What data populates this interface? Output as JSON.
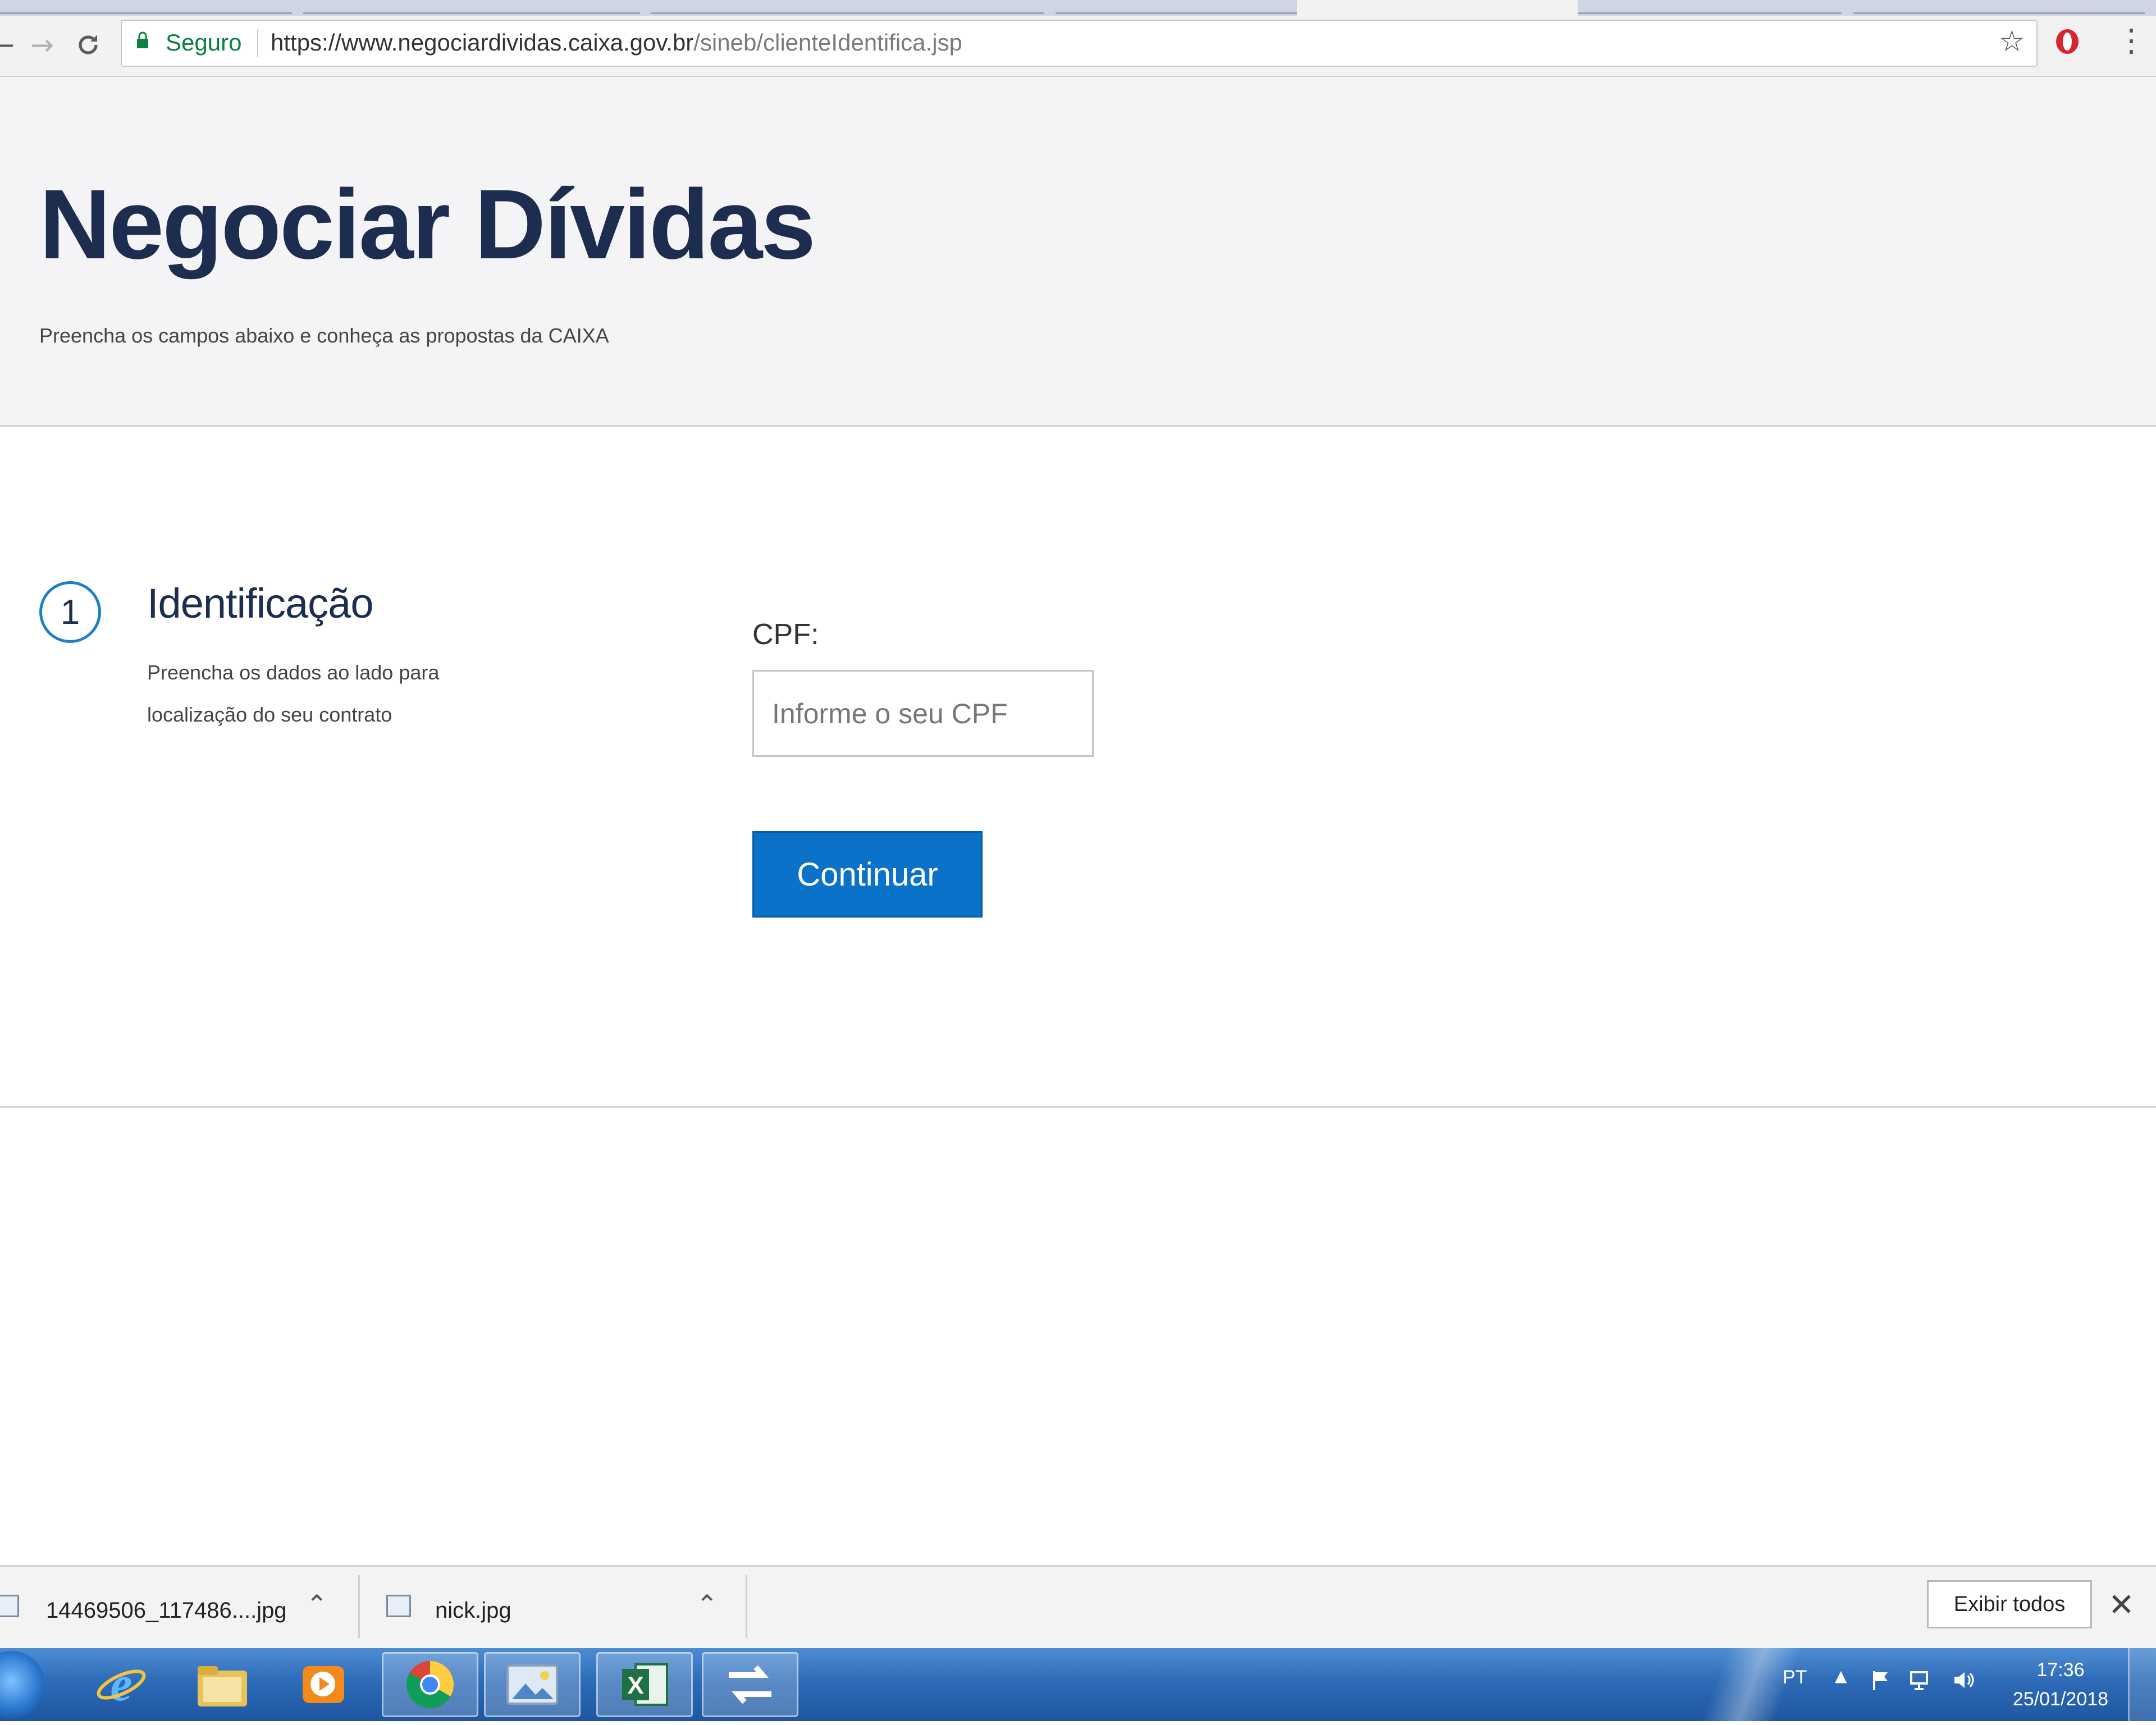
{
  "browser": {
    "security_label": "Seguro",
    "url_host": "https://www.negociardividas.caixa.gov.br",
    "url_path": "/sineb/clienteIdentifica.jsp",
    "back_icon": "back-arrow-icon",
    "forward_icon": "forward-arrow-icon",
    "reload_icon": "reload-icon"
  },
  "header": {
    "title": "Negociar Dívidas",
    "subtitle": "Preencha os campos abaixo e conheça as propostas da CAIXA"
  },
  "step": {
    "number": "1",
    "title": "Identificação",
    "description": "Preencha os dados ao lado para localização do seu contrato"
  },
  "form": {
    "cpf_label": "CPF:",
    "cpf_placeholder": "Informe o seu CPF",
    "cpf_value": "",
    "continue_label": "Continuar"
  },
  "downloads": {
    "items": [
      {
        "name": "14469506_117486....jpg"
      },
      {
        "name": "nick.jpg"
      }
    ],
    "show_all_label": "Exibir todos"
  },
  "taskbar": {
    "language": "PT",
    "time": "17:36",
    "date": "25/01/2018"
  },
  "colors": {
    "accent": "#0b72c9",
    "title": "#1d2d50",
    "secure_green": "#0b8043",
    "taskbar": "#2d6bb8"
  }
}
